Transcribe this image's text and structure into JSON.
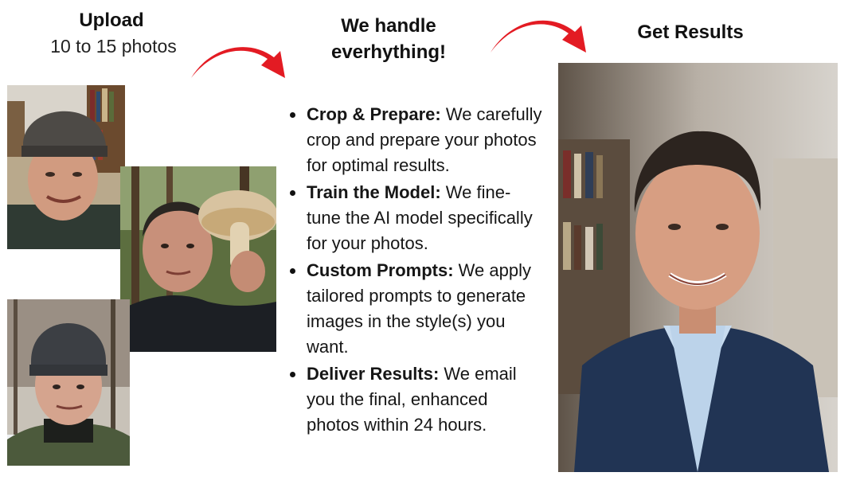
{
  "upload": {
    "title": "Upload",
    "subtitle": "10 to 15 photos"
  },
  "handle": {
    "title_line1": "We handle",
    "title_line2": "everhything!"
  },
  "results": {
    "title": "Get Results"
  },
  "steps": [
    {
      "bold": "Crop & Prepare:",
      "text": " We carefully crop and prepare your photos for optimal results."
    },
    {
      "bold": "Train the Model:",
      "text": " We fine-tune the AI model specifically for your photos."
    },
    {
      "bold": "Custom Prompts:",
      "text": " We apply tailored prompts to generate images in the style(s) you want."
    },
    {
      "bold": "Deliver Results:",
      "text": " We email you the final, enhanced photos within 24 hours."
    }
  ],
  "colors": {
    "arrow": "#e31b23",
    "text": "#111111",
    "background": "#ffffff"
  },
  "icons": {
    "arrow_1": "curved-arrow-right-icon",
    "arrow_2": "curved-arrow-right-icon"
  }
}
